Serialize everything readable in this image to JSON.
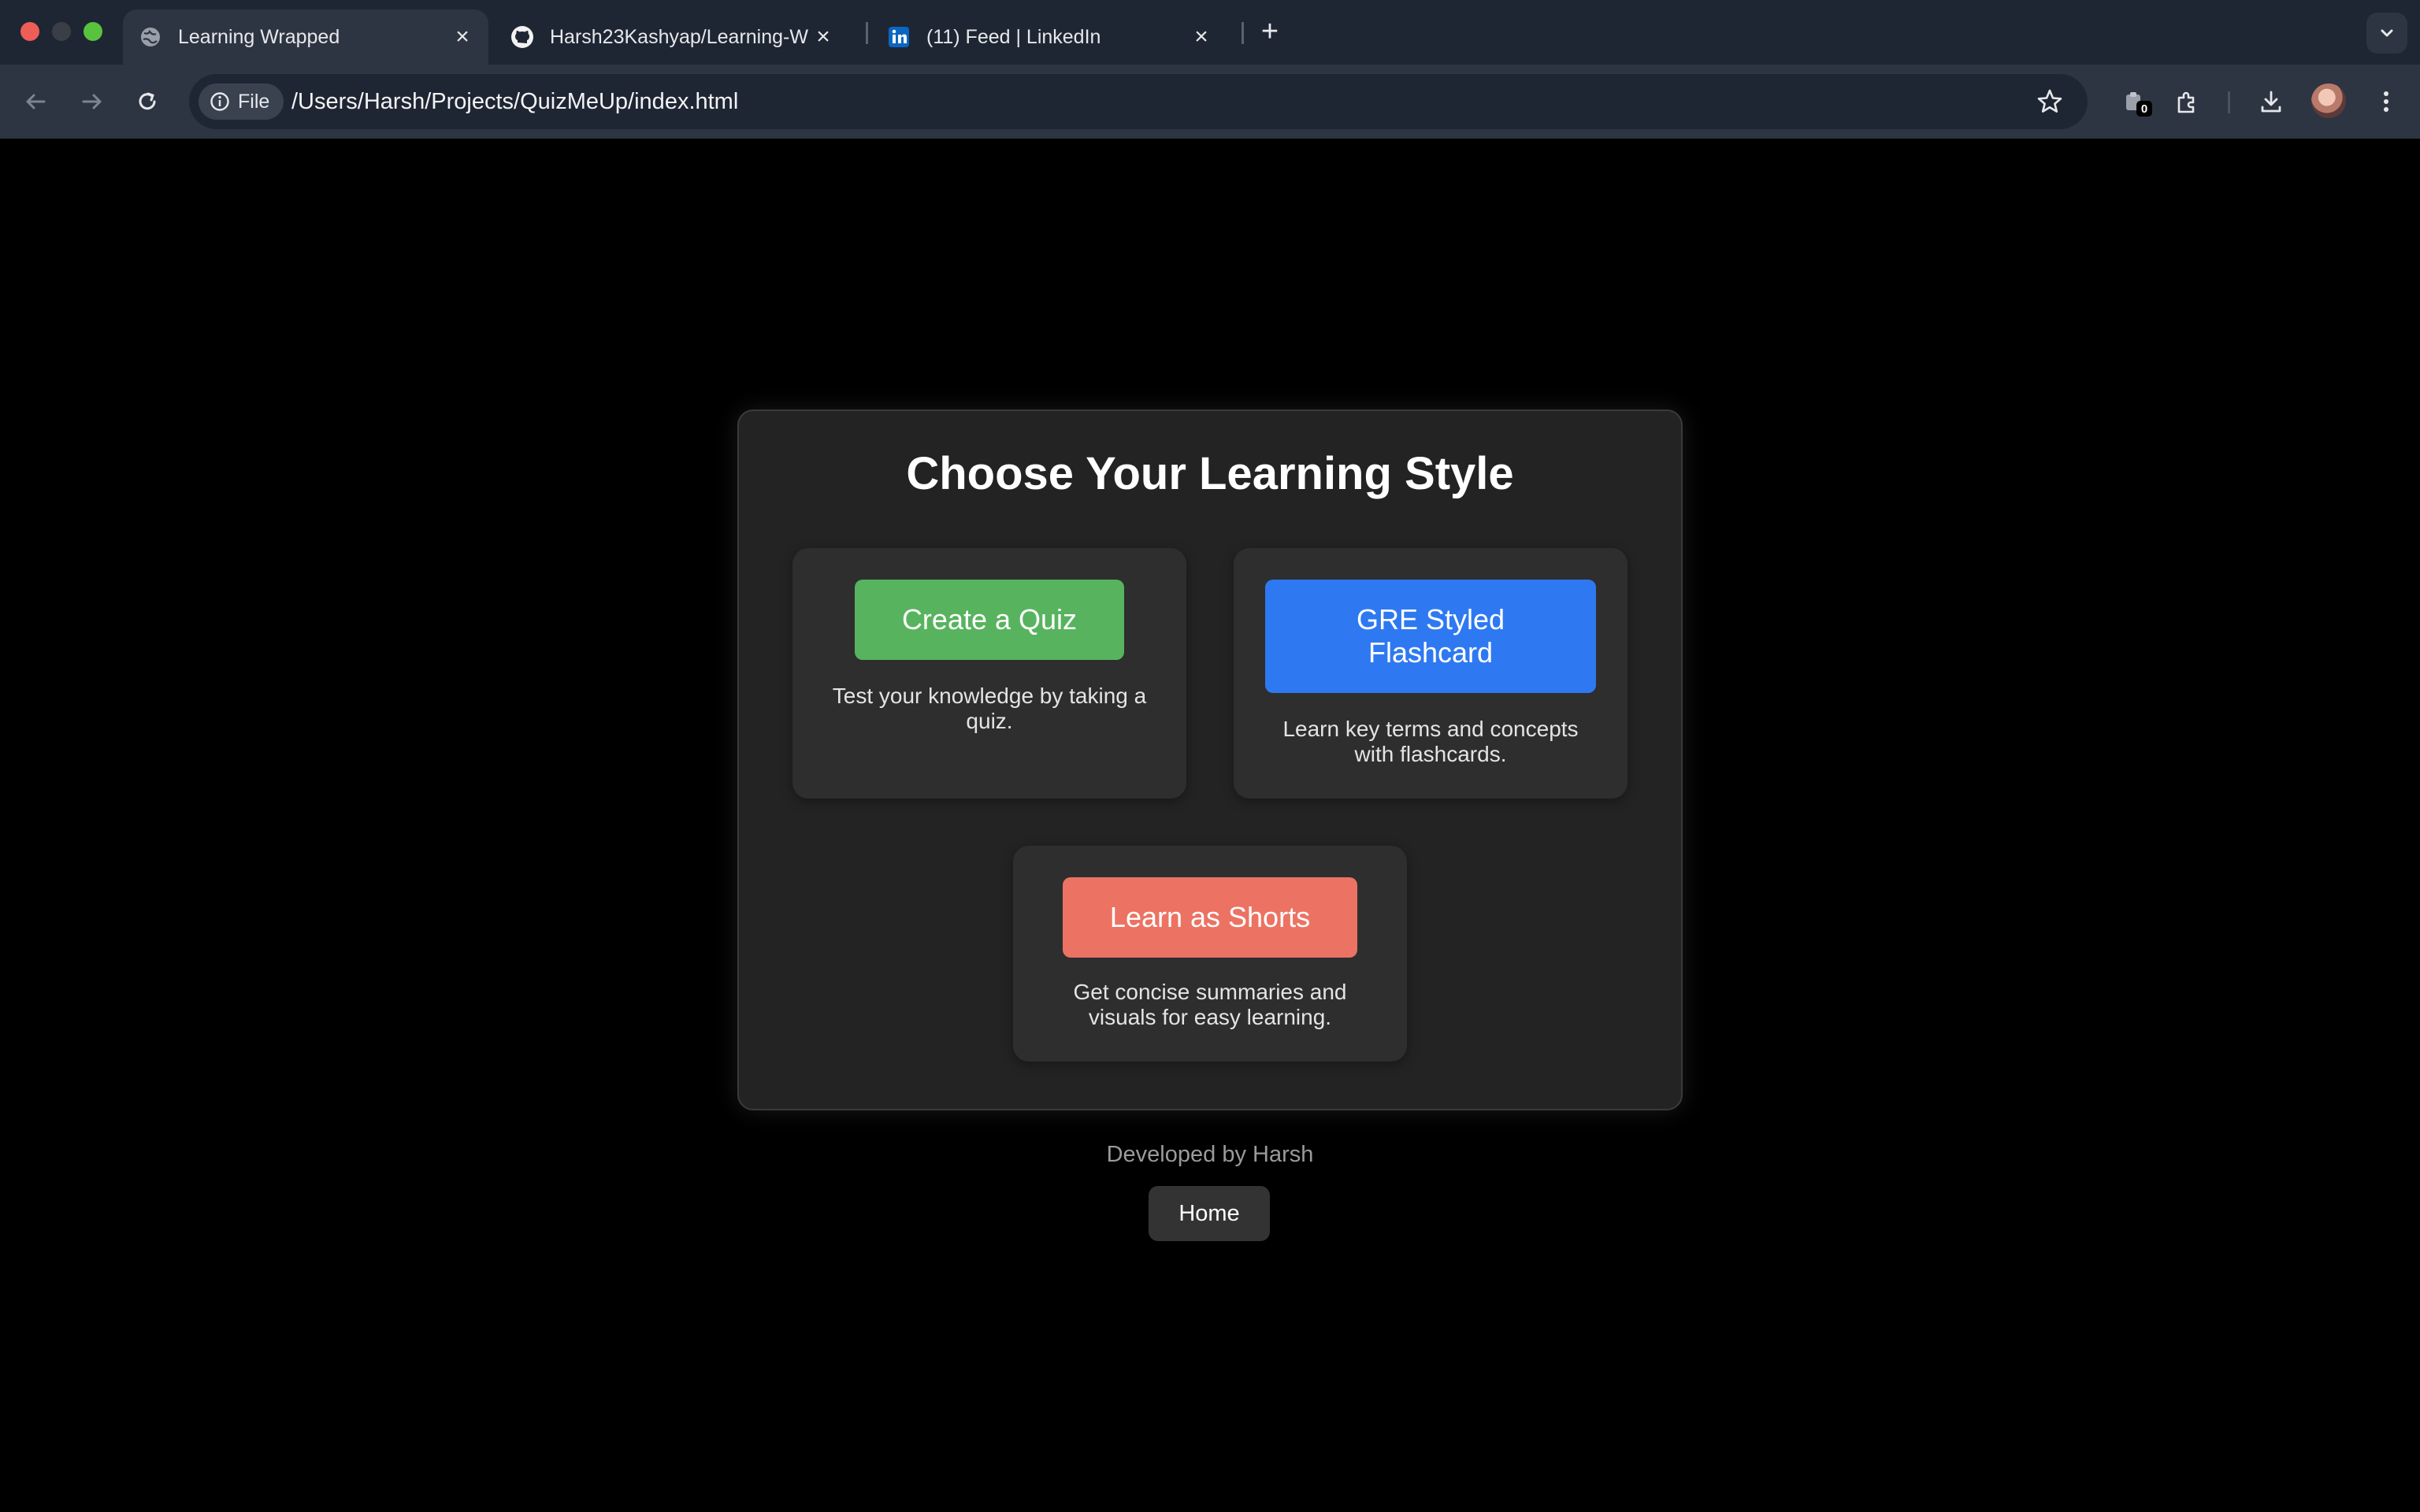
{
  "browser": {
    "tabs": [
      {
        "title": "Learning Wrapped",
        "icon": "globe-icon",
        "active": true
      },
      {
        "title": "Harsh23Kashyap/Learning-W",
        "icon": "github-icon",
        "active": false
      },
      {
        "title": "(11) Feed | LinkedIn",
        "icon": "linkedin-icon",
        "active": false
      }
    ],
    "new_tab_label": "+",
    "close_label": "×",
    "address": {
      "chip_label": "File",
      "url": "/Users/Harsh/Projects/QuizMeUp/index.html"
    },
    "extension_badge": "0"
  },
  "main": {
    "heading": "Choose Your Learning Style",
    "options": [
      {
        "button": "Create a Quiz",
        "description": "Test your knowledge by taking a quiz.",
        "color": "#58b35e"
      },
      {
        "button": "GRE Styled Flashcard",
        "description": "Learn key terms and concepts with flashcards.",
        "color": "#2e79f1"
      },
      {
        "button": "Learn as Shorts",
        "description": "Get concise summaries and visuals for easy learning.",
        "color": "#ec7363"
      }
    ]
  },
  "footer": {
    "credit": "Developed by Harsh",
    "home_label": "Home"
  }
}
